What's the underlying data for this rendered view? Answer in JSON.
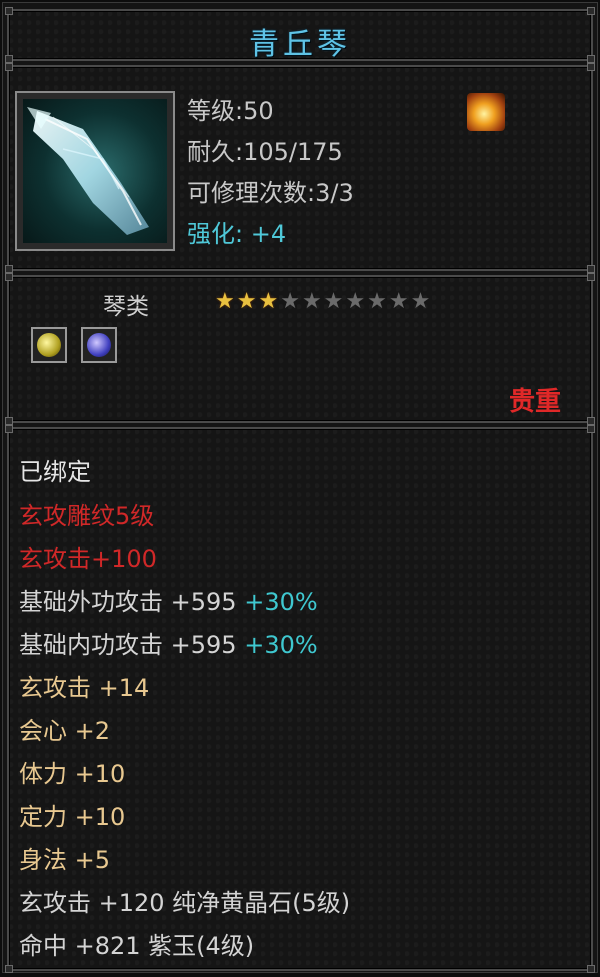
{
  "title": "青丘琴",
  "header": {
    "level": "等级:50",
    "durability": "耐久:105/175",
    "repairs": "可修理次数:3/3",
    "enhance": "强化: +4",
    "item_icon": "qin-instrument-icon",
    "fire_icon": "fire-icon"
  },
  "class_row": {
    "category": "琴类",
    "stars_filled": 3,
    "stars_total": 10,
    "gems": [
      "yellow-gem-icon",
      "purple-gem-icon"
    ],
    "rarity": "贵重"
  },
  "attributes": {
    "bound": "已绑定",
    "engrave": "玄攻雕纹5级",
    "xuan_attack_red": "玄攻击+100",
    "outer_label": "基础外功攻击",
    "outer_value": "+595",
    "outer_pct": "+30%",
    "inner_label": "基础内功攻击",
    "inner_value": "+595",
    "inner_pct": "+30%",
    "xuan_attack": "玄攻击 +14",
    "crit": "会心 +2",
    "stamina": "体力 +10",
    "focus": "定力 +10",
    "agility": "身法 +5",
    "gem1": "玄攻击 +120 纯净黄晶石(5级)",
    "gem2": "命中 +821 紫玉(4级)"
  },
  "colors": {
    "title": "#5fc3e6",
    "rarity": "#e02828",
    "engrave": "#d02828",
    "percent": "#3fc8d0",
    "gem_text": "#e8c890",
    "star_on": "#e8c040"
  }
}
